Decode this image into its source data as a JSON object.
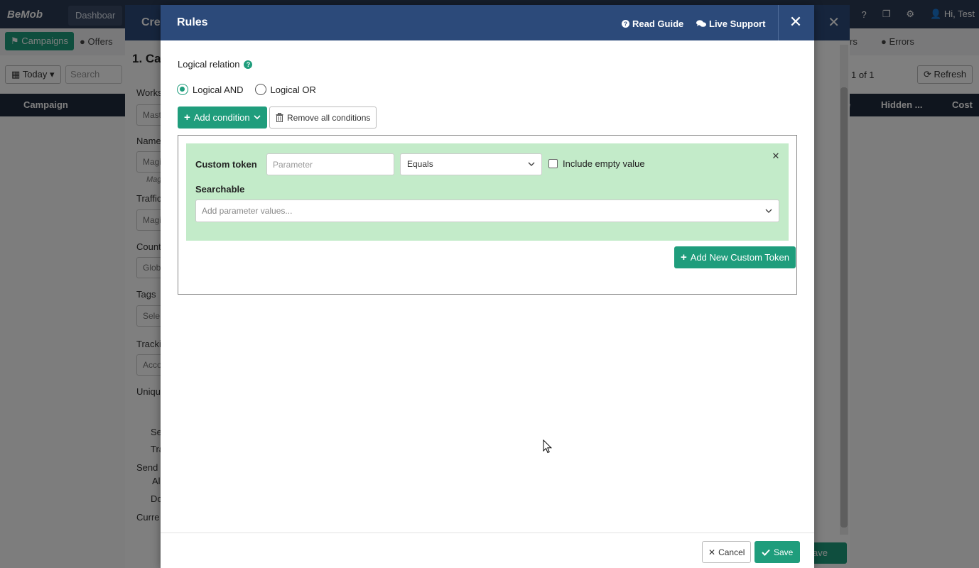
{
  "background_app": {
    "logo": "BeMob",
    "dashboard_tab": "Dashboar",
    "user_greeting": "Hi, Test",
    "campaigns_button": "Campaigns",
    "offers_label": "Offers",
    "ers_label": "rs",
    "errors_label": "Errors",
    "today_button": "Today",
    "search_placeholder": "Search",
    "pager_text": "1   of 1",
    "refresh_button": "Refresh",
    "table_headers": {
      "campaign": "Campaign",
      "e": "e",
      "hidden": "Hidden ...",
      "cost": "Cost"
    }
  },
  "create_panel": {
    "title": "Crea",
    "step_heading": "1. Ca",
    "labels": [
      "Works",
      "Name",
      "Traffic",
      "Count",
      "Tags",
      "Tracki",
      "Uniqu",
      "Se",
      "Tra",
      "Send",
      "Al",
      "Do",
      "Curre"
    ],
    "fields": [
      "Mast",
      "Magi",
      "Magi",
      "Glob",
      "Sele",
      "Acco"
    ],
    "name_hint": "Mag",
    "save_button": "ave"
  },
  "modal": {
    "title": "Rules",
    "read_guide": "Read Guide",
    "live_support": "Live Support",
    "logical_relation_label": "Logical relation",
    "logic_options": [
      {
        "label": "Logical AND",
        "checked": true
      },
      {
        "label": "Logical OR",
        "checked": false
      }
    ],
    "add_condition_button": "Add condition",
    "remove_all_button": "Remove all conditions",
    "condition": {
      "title": "Custom token",
      "parameter_placeholder": "Parameter",
      "parameter_value": "",
      "operator": "Equals",
      "include_empty_label": "Include empty value",
      "include_empty_checked": false,
      "searchable_label": "Searchable",
      "values_placeholder": "Add parameter values..."
    },
    "add_custom_token_button": "Add New Custom Token",
    "cancel_button": "Cancel",
    "save_button": "Save"
  },
  "colors": {
    "accent": "#1f9d7c",
    "header": "#2c4a7a",
    "condition_card": "#c3ebc9"
  }
}
